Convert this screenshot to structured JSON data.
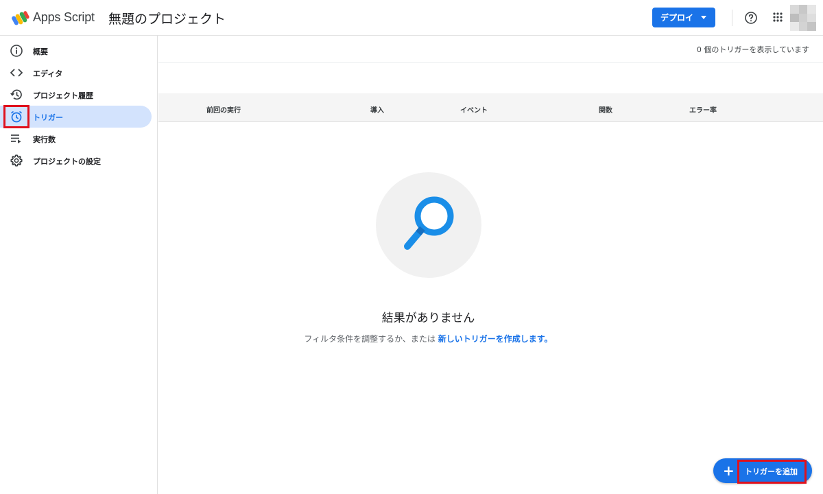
{
  "header": {
    "app_name": "Apps Script",
    "project_title": "無題のプロジェクト",
    "deploy_label": "デプロイ",
    "help_icon": "help-circle-icon",
    "apps_icon": "apps-grid-icon"
  },
  "sidebar": {
    "items": [
      {
        "label": "概要",
        "icon": "info-icon"
      },
      {
        "label": "エディタ",
        "icon": "code-icon"
      },
      {
        "label": "プロジェクト履歴",
        "icon": "history-icon"
      },
      {
        "label": "トリガー",
        "icon": "alarm-clock-icon",
        "active": true
      },
      {
        "label": "実行数",
        "icon": "executions-list-icon"
      },
      {
        "label": "プロジェクトの設定",
        "icon": "gear-icon"
      }
    ]
  },
  "main": {
    "trigger_count_text": "0 個のトリガーを表示しています",
    "columns": [
      "前回の実行",
      "導入",
      "イベント",
      "関数",
      "エラー率"
    ],
    "empty_title": "結果がありません",
    "empty_sub_prefix": "フィルタ条件を調整するか、または",
    "empty_sub_link": "新しいトリガーを作成します。",
    "add_trigger_label": "トリガーを追加"
  },
  "colors": {
    "accent": "#1a73e8",
    "active_nav_bg": "#d3e3fd",
    "highlight": "#e0111d"
  }
}
